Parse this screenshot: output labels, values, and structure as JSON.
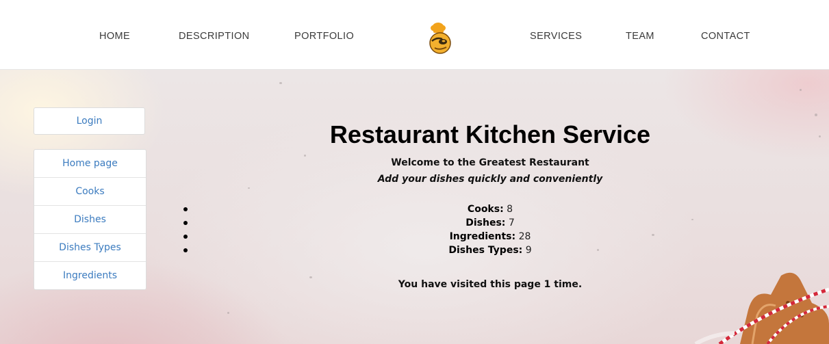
{
  "nav": {
    "left_links": [
      "HOME",
      "DESCRIPTION",
      "PORTFOLIO"
    ],
    "right_links": [
      "SERVICES",
      "TEAM",
      "CONTACT"
    ]
  },
  "sidebar": {
    "login_label": "Login",
    "items": [
      {
        "label": "Home page"
      },
      {
        "label": "Cooks"
      },
      {
        "label": "Dishes"
      },
      {
        "label": "Dishes Types"
      },
      {
        "label": "Ingredients"
      }
    ]
  },
  "main": {
    "title": "Restaurant Kitchen Service",
    "welcome": "Welcome to the Greatest Restaurant",
    "tagline": "Add your dishes quickly and conveniently",
    "stats": [
      {
        "label": "Cooks:",
        "value": "8"
      },
      {
        "label": "Dishes:",
        "value": "7"
      },
      {
        "label": "Ingredients:",
        "value": "28"
      },
      {
        "label": "Dishes Types:",
        "value": "9"
      }
    ],
    "visits": "You have visited this page 1 time."
  },
  "colors": {
    "link": "#3b7bbf",
    "logo_orange": "#f0a020"
  }
}
